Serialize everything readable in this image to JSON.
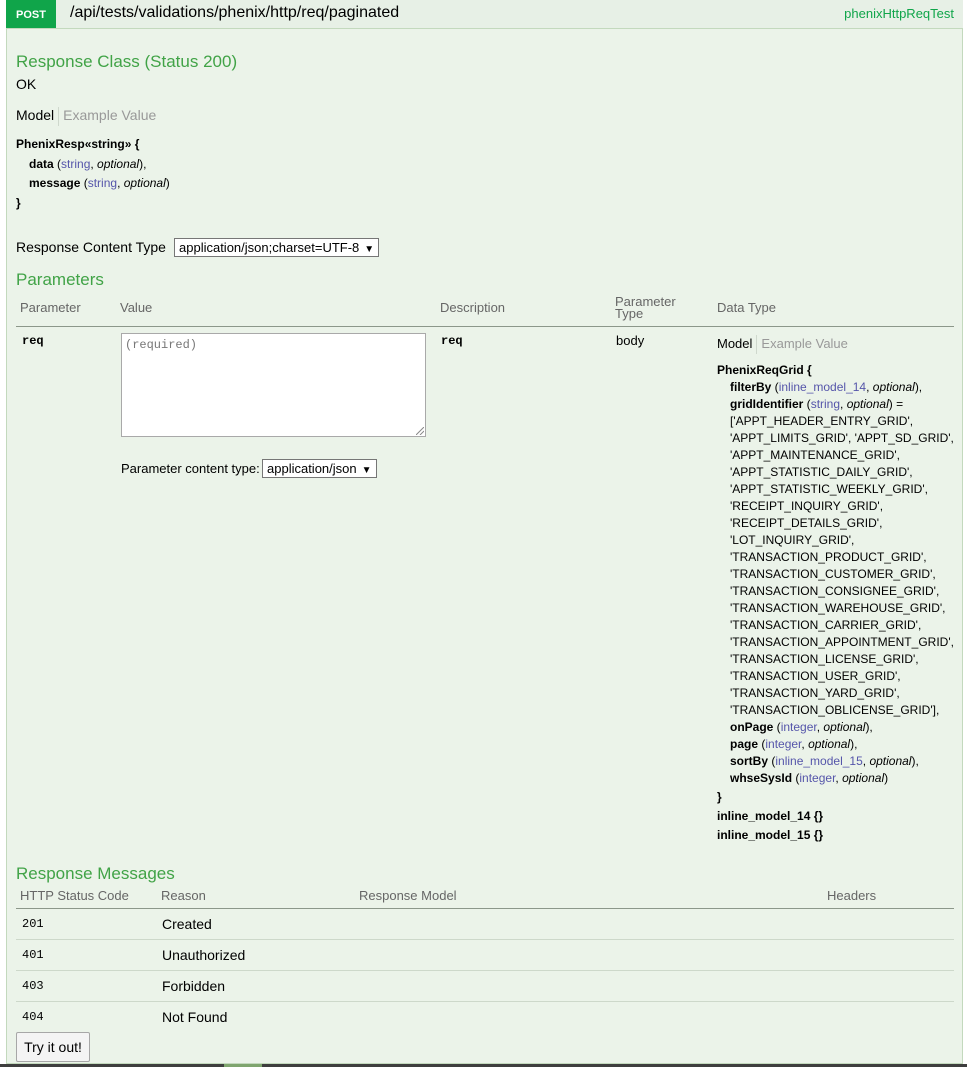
{
  "endpoint": {
    "method": "POST",
    "path": "/api/tests/validations/phenix/http/req/paginated",
    "tag": "phenixHttpReqTest"
  },
  "response_class": {
    "title": "Response Class (Status 200)",
    "status_text": "OK",
    "tab_model": "Model",
    "tab_example": "Example Value",
    "model": {
      "header": "PhenixResp«string» {",
      "fields": [
        {
          "name": "data",
          "type": "string",
          "opt": "optional",
          "end": "),"
        },
        {
          "name": "message",
          "type": "string",
          "opt": "optional",
          "end": ")"
        }
      ],
      "close": "}"
    }
  },
  "content_type": {
    "label": "Response Content Type",
    "value": "application/json;charset=UTF-8"
  },
  "parameters": {
    "title": "Parameters",
    "headers": {
      "parameter": "Parameter",
      "value": "Value",
      "description": "Description",
      "ptype_1": "Parameter",
      "ptype_2": "Type",
      "data_type": "Data Type"
    },
    "row": {
      "name": "req",
      "placeholder": "(required)",
      "description": "req",
      "type": "body",
      "param_content_type_label": "Parameter content type:",
      "param_content_type_value": "application/json",
      "tab_model": "Model",
      "tab_example": "Example Value",
      "model": {
        "header": "PhenixReqGrid {",
        "filterBy": {
          "name": "filterBy",
          "type": "inline_model_14",
          "opt": "optional",
          "end": "),"
        },
        "gridIdentifier": {
          "name": "gridIdentifier",
          "type": "string",
          "opt": "optional",
          "end": ") ="
        },
        "enum_lines": [
          "['APPT_HEADER_ENTRY_GRID',",
          "'APPT_LIMITS_GRID', 'APPT_SD_GRID',",
          "'APPT_MAINTENANCE_GRID',",
          "'APPT_STATISTIC_DAILY_GRID',",
          "'APPT_STATISTIC_WEEKLY_GRID',",
          "'RECEIPT_INQUIRY_GRID',",
          "'RECEIPT_DETAILS_GRID',",
          "'LOT_INQUIRY_GRID',",
          "'TRANSACTION_PRODUCT_GRID',",
          "'TRANSACTION_CUSTOMER_GRID',",
          "'TRANSACTION_CONSIGNEE_GRID',",
          "'TRANSACTION_WAREHOUSE_GRID',",
          "'TRANSACTION_CARRIER_GRID',",
          "'TRANSACTION_APPOINTMENT_GRID',",
          "'TRANSACTION_LICENSE_GRID',",
          "'TRANSACTION_USER_GRID',",
          "'TRANSACTION_YARD_GRID',",
          "'TRANSACTION_OBLICENSE_GRID'],"
        ],
        "onPage": {
          "name": "onPage",
          "type": "integer",
          "opt": "optional",
          "end": "),"
        },
        "page": {
          "name": "page",
          "type": "integer",
          "opt": "optional",
          "end": "),"
        },
        "sortBy": {
          "name": "sortBy",
          "type": "inline_model_15",
          "opt": "optional",
          "end": "),"
        },
        "whseSysId": {
          "name": "whseSysId",
          "type": "integer",
          "opt": "optional",
          "end": ")"
        },
        "close": "}",
        "extra_1": "inline_model_14 {}",
        "extra_2": "inline_model_15 {}"
      }
    }
  },
  "response_messages": {
    "title": "Response Messages",
    "headers": {
      "code": "HTTP Status Code",
      "reason": "Reason",
      "model": "Response Model",
      "headers": "Headers"
    },
    "rows": [
      {
        "code": "201",
        "reason": "Created"
      },
      {
        "code": "401",
        "reason": "Unauthorized"
      },
      {
        "code": "403",
        "reason": "Forbidden"
      },
      {
        "code": "404",
        "reason": "Not Found"
      }
    ]
  },
  "try_button": "Try it out!"
}
